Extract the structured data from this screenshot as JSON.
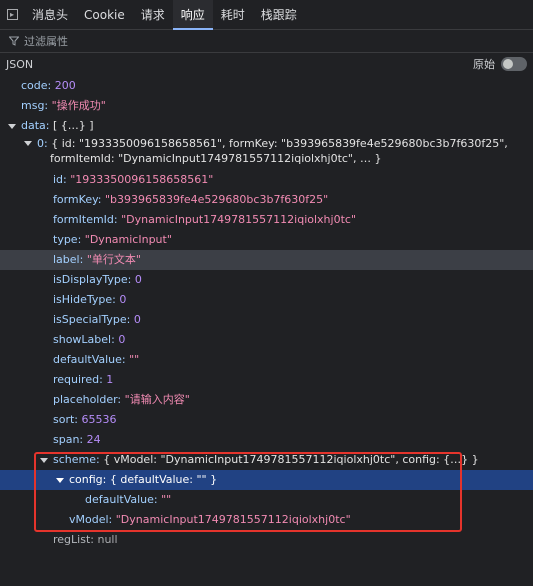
{
  "tabs": [
    "消息头",
    "Cookie",
    "请求",
    "响应",
    "耗时",
    "栈跟踪"
  ],
  "filter_placeholder": "过滤属性",
  "json_title": "JSON",
  "raw_label": "原始",
  "tree": {
    "code_key": "code:",
    "code_val": "200",
    "msg_key": "msg:",
    "msg_val": "\"操作成功\"",
    "data_key": "data:",
    "data_val": "[ {…} ]",
    "item0_key": "0:",
    "item0_line1": "{ id: \"1933350096158658561\", formKey: \"b393965839fe4e529680bc3b7f630f25\",",
    "item0_line2": "formItemId: \"DynamicInput1749781557112iqiolxhj0tc\", … }",
    "id_key": "id:",
    "id_val": "\"1933350096158658561\"",
    "formKey_key": "formKey:",
    "formKey_val": "\"b393965839fe4e529680bc3b7f630f25\"",
    "formItemId_key": "formItemId:",
    "formItemId_val": "\"DynamicInput1749781557112iqiolxhj0tc\"",
    "type_key": "type:",
    "type_val": "\"DynamicInput\"",
    "label_key": "label:",
    "label_val": "\"单行文本\"",
    "isDisplayType_key": "isDisplayType:",
    "isDisplayType_val": "0",
    "isHideType_key": "isHideType:",
    "isHideType_val": "0",
    "isSpecialType_key": "isSpecialType:",
    "isSpecialType_val": "0",
    "showLabel_key": "showLabel:",
    "showLabel_val": "0",
    "defaultValue_key": "defaultValue:",
    "defaultValue_val": "\"\"",
    "required_key": "required:",
    "required_val": "1",
    "placeholder_key": "placeholder:",
    "placeholder_val": "\"请输入内容\"",
    "sort_key": "sort:",
    "sort_val": "65536",
    "span_key": "span:",
    "span_val": "24",
    "scheme_key": "scheme:",
    "scheme_val": "{ vModel: \"DynamicInput1749781557112iqiolxhj0tc\", config: {…} }",
    "config_key": "config:",
    "config_val": "{ defaultValue: \"\" }",
    "config_default_key": "defaultValue:",
    "config_default_val": "\"\"",
    "vModel_key": "vModel:",
    "vModel_val": "\"DynamicInput1749781557112iqiolxhj0tc\"",
    "regList_key": "regList:",
    "regList_val": "null"
  },
  "colors": {
    "background": "#202124",
    "key": "#a3d0ff",
    "string": "#f28bb3",
    "number": "#b58df8",
    "selected_row": "#214283",
    "hover_row": "#3c3f46",
    "annotation_box": "#e5342c"
  }
}
